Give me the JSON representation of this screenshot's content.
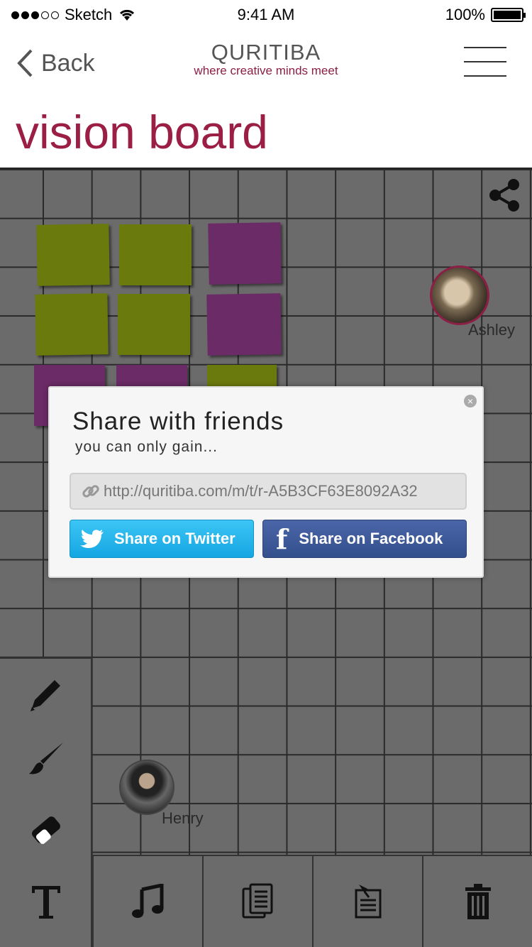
{
  "status_bar": {
    "carrier": "Sketch",
    "time": "9:41 AM",
    "battery": "100%",
    "battery_level": 1.0
  },
  "nav": {
    "back_label": "Back",
    "brand_name": "QURITIBA",
    "brand_tagline": "where creative minds meet"
  },
  "page": {
    "title": "vision board"
  },
  "board": {
    "collaborators": [
      {
        "name": "Ashley"
      },
      {
        "name": "Henry"
      }
    ]
  },
  "share_dialog": {
    "title": "Share with friends",
    "subtitle": "you can only gain...",
    "url": "http://quritiba.com/m/t/r-A5B3CF63E8092A32",
    "twitter_label": "Share on Twitter",
    "facebook_label": "Share on Facebook",
    "close_label": "×"
  },
  "tools": {
    "left": [
      "pencil-icon",
      "brush-icon",
      "eraser-icon",
      "text-icon"
    ],
    "bottom": [
      "music-icon",
      "copy-icon",
      "pin-note-icon",
      "trash-icon"
    ]
  },
  "colors": {
    "accent": "#9b1e45",
    "board_bg": "#6b6b6b",
    "note_green": "#6b7a0c",
    "note_purple": "#6b2b66",
    "twitter": "#1da8e4",
    "facebook": "#3b5998"
  }
}
